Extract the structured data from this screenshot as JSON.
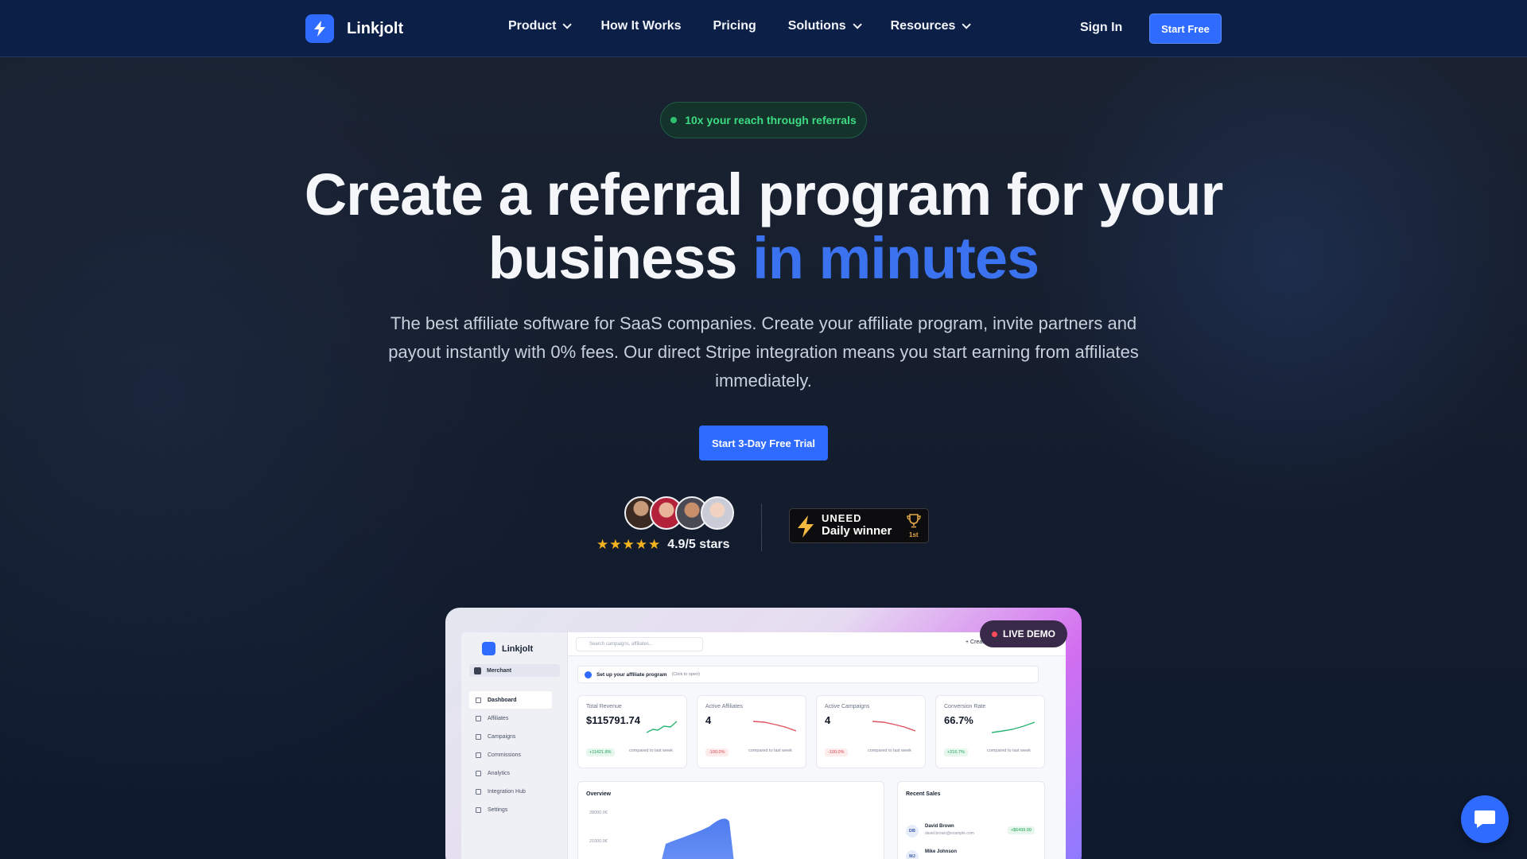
{
  "nav": {
    "brand": "Linkjolt",
    "links": [
      {
        "label": "Product",
        "dropdown": true
      },
      {
        "label": "How It Works",
        "dropdown": false
      },
      {
        "label": "Pricing",
        "dropdown": false
      },
      {
        "label": "Solutions",
        "dropdown": true
      },
      {
        "label": "Resources",
        "dropdown": true
      }
    ],
    "sign_in": "Sign In",
    "start_free": "Start Free"
  },
  "hero": {
    "pill": "10x your reach through referrals",
    "headline_line1": "Create a referral program for your",
    "headline_line2_plain": "business ",
    "headline_line2_accent": "in minutes",
    "subtext": "The best affiliate software for SaaS companies. Create your affiliate program, invite partners and payout instantly with 0% fees. Our direct Stripe integration means you start earning from affiliates immediately.",
    "cta": "Start 3-Day Free Trial",
    "stars": "★★★★★",
    "rating": "4.9/5 stars",
    "badge": {
      "brand": "UNEED",
      "title": "Daily winner",
      "rank": "1st"
    }
  },
  "demo": {
    "live_label": "LIVE DEMO",
    "brand": "Linkjolt",
    "merchant": "Merchant",
    "search_placeholder": "Search campaigns, affiliates...",
    "create": "+ Create",
    "setup_title": "Set up your affiliate program",
    "setup_hint": "(Click to open)",
    "sidebar": [
      "Dashboard",
      "Affiliates",
      "Campaigns",
      "Commissions",
      "Analytics",
      "Integration Hub",
      "Settings"
    ],
    "cards": [
      {
        "label": "Total Revenue",
        "value": "$115791.74",
        "change": "+11421.8%",
        "compare": "compared to last week",
        "trend": "up"
      },
      {
        "label": "Active Affiliates",
        "value": "4",
        "change": "-100.0%",
        "compare": "compared to last week",
        "trend": "down"
      },
      {
        "label": "Active Campaigns",
        "value": "4",
        "change": "-100.0%",
        "compare": "compared to last week",
        "trend": "down"
      },
      {
        "label": "Conversion Rate",
        "value": "66.7%",
        "change": "+216.7%",
        "compare": "compared to last week",
        "trend": "up"
      }
    ],
    "overview": {
      "title": "Overview",
      "y_labels": [
        "28000.0€",
        "21000.0€"
      ]
    },
    "recent_sales": {
      "title": "Recent Sales",
      "rows": [
        {
          "initials": "DB",
          "name": "David Brown",
          "email": "david.brown@example.com",
          "amount": "+$6499.99"
        },
        {
          "initials": "MJ",
          "name": "Mike Johnson",
          "email": "",
          "amount": ""
        }
      ]
    }
  },
  "colors": {
    "accent": "#2f6bff",
    "accent_text": "#3a72f0",
    "pill_green": "#3ddc84",
    "star": "#f5b31e"
  }
}
